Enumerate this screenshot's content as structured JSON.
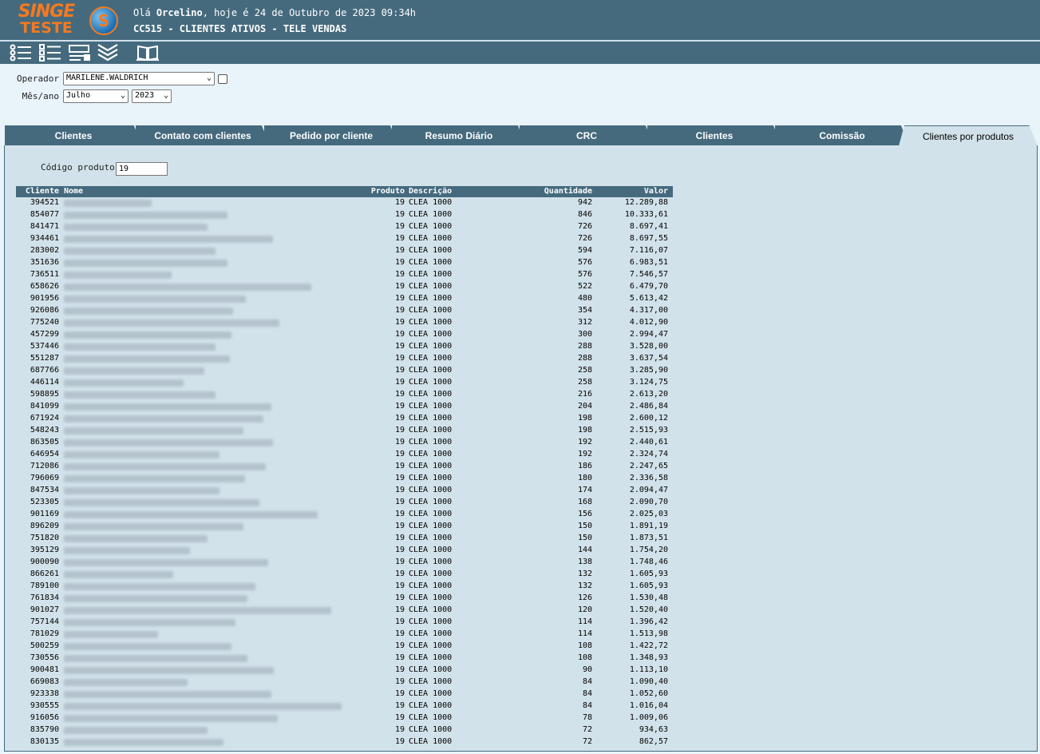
{
  "app": {
    "logo_line1": "SINGE",
    "logo_line2": "TESTE",
    "greeting_prefix": "Olá ",
    "user": "Orcelino",
    "greeting_suffix": ", hoje é 24 de Outubro de 2023 09:34h",
    "screen_title": "CC515 - CLIENTES ATIVOS - TELE VENDAS"
  },
  "toolbar": {
    "icons": [
      "list-icon",
      "checklist-icon",
      "form-icon",
      "chevrons-down-icon",
      "book-icon"
    ]
  },
  "filters": {
    "operador_label": "Operador",
    "operador_value": "MARILENE.WALDRICH",
    "mes_ano_label": "Mês/ano",
    "mes_value": "Julho",
    "ano_value": "2023"
  },
  "tabs": [
    {
      "label": "Clientes"
    },
    {
      "label": "Contato com clientes"
    },
    {
      "label": "Pedido por cliente"
    },
    {
      "label": "Resumo Diário"
    },
    {
      "label": "CRC"
    },
    {
      "label": "Clientes"
    },
    {
      "label": "Comissão"
    },
    {
      "label": "Clientes por produtos",
      "active": true
    }
  ],
  "produto_filter": {
    "label": "Código produto",
    "value": "19"
  },
  "table": {
    "columns": [
      "Cliente",
      "Nome",
      "Produto",
      "Descrição",
      "Quantidade",
      "Valor"
    ],
    "rows": [
      {
        "cliente": "394521",
        "produto": "19",
        "descricao": "CLEA 1000",
        "quantidade": "942",
        "valor": "12.289,88"
      },
      {
        "cliente": "854077",
        "produto": "19",
        "descricao": "CLEA 1000",
        "quantidade": "846",
        "valor": "10.333,61"
      },
      {
        "cliente": "841471",
        "produto": "19",
        "descricao": "CLEA 1000",
        "quantidade": "726",
        "valor": "8.697,41"
      },
      {
        "cliente": "934461",
        "produto": "19",
        "descricao": "CLEA 1000",
        "quantidade": "726",
        "valor": "8.697,55"
      },
      {
        "cliente": "283002",
        "produto": "19",
        "descricao": "CLEA 1000",
        "quantidade": "594",
        "valor": "7.116,07"
      },
      {
        "cliente": "351636",
        "produto": "19",
        "descricao": "CLEA 1000",
        "quantidade": "576",
        "valor": "6.983,51"
      },
      {
        "cliente": "736511",
        "produto": "19",
        "descricao": "CLEA 1000",
        "quantidade": "576",
        "valor": "7.546,57"
      },
      {
        "cliente": "658626",
        "produto": "19",
        "descricao": "CLEA 1000",
        "quantidade": "522",
        "valor": "6.479,70"
      },
      {
        "cliente": "901956",
        "produto": "19",
        "descricao": "CLEA 1000",
        "quantidade": "480",
        "valor": "5.613,42"
      },
      {
        "cliente": "926086",
        "produto": "19",
        "descricao": "CLEA 1000",
        "quantidade": "354",
        "valor": "4.317,00"
      },
      {
        "cliente": "775240",
        "produto": "19",
        "descricao": "CLEA 1000",
        "quantidade": "312",
        "valor": "4.012,90"
      },
      {
        "cliente": "457299",
        "produto": "19",
        "descricao": "CLEA 1000",
        "quantidade": "300",
        "valor": "2.994,47"
      },
      {
        "cliente": "537446",
        "produto": "19",
        "descricao": "CLEA 1000",
        "quantidade": "288",
        "valor": "3.528,00"
      },
      {
        "cliente": "551287",
        "produto": "19",
        "descricao": "CLEA 1000",
        "quantidade": "288",
        "valor": "3.637,54"
      },
      {
        "cliente": "687766",
        "produto": "19",
        "descricao": "CLEA 1000",
        "quantidade": "258",
        "valor": "3.285,90"
      },
      {
        "cliente": "446114",
        "produto": "19",
        "descricao": "CLEA 1000",
        "quantidade": "258",
        "valor": "3.124,75"
      },
      {
        "cliente": "598895",
        "produto": "19",
        "descricao": "CLEA 1000",
        "quantidade": "216",
        "valor": "2.613,20"
      },
      {
        "cliente": "841099",
        "produto": "19",
        "descricao": "CLEA 1000",
        "quantidade": "204",
        "valor": "2.486,84"
      },
      {
        "cliente": "671924",
        "produto": "19",
        "descricao": "CLEA 1000",
        "quantidade": "198",
        "valor": "2.600,12"
      },
      {
        "cliente": "548243",
        "produto": "19",
        "descricao": "CLEA 1000",
        "quantidade": "198",
        "valor": "2.515,93"
      },
      {
        "cliente": "863505",
        "produto": "19",
        "descricao": "CLEA 1000",
        "quantidade": "192",
        "valor": "2.440,61"
      },
      {
        "cliente": "646954",
        "produto": "19",
        "descricao": "CLEA 1000",
        "quantidade": "192",
        "valor": "2.324,74"
      },
      {
        "cliente": "712086",
        "produto": "19",
        "descricao": "CLEA 1000",
        "quantidade": "186",
        "valor": "2.247,65"
      },
      {
        "cliente": "796069",
        "produto": "19",
        "descricao": "CLEA 1000",
        "quantidade": "180",
        "valor": "2.336,58"
      },
      {
        "cliente": "847534",
        "produto": "19",
        "descricao": "CLEA 1000",
        "quantidade": "174",
        "valor": "2.094,47"
      },
      {
        "cliente": "523305",
        "produto": "19",
        "descricao": "CLEA 1000",
        "quantidade": "168",
        "valor": "2.090,70"
      },
      {
        "cliente": "901169",
        "produto": "19",
        "descricao": "CLEA 1000",
        "quantidade": "156",
        "valor": "2.025,03"
      },
      {
        "cliente": "896209",
        "produto": "19",
        "descricao": "CLEA 1000",
        "quantidade": "150",
        "valor": "1.891,19"
      },
      {
        "cliente": "751820",
        "produto": "19",
        "descricao": "CLEA 1000",
        "quantidade": "150",
        "valor": "1.873,51"
      },
      {
        "cliente": "395129",
        "produto": "19",
        "descricao": "CLEA 1000",
        "quantidade": "144",
        "valor": "1.754,20"
      },
      {
        "cliente": "900090",
        "produto": "19",
        "descricao": "CLEA 1000",
        "quantidade": "138",
        "valor": "1.748,46"
      },
      {
        "cliente": "866261",
        "produto": "19",
        "descricao": "CLEA 1000",
        "quantidade": "132",
        "valor": "1.605,93"
      },
      {
        "cliente": "789100",
        "produto": "19",
        "descricao": "CLEA 1000",
        "quantidade": "132",
        "valor": "1.605,93"
      },
      {
        "cliente": "761834",
        "produto": "19",
        "descricao": "CLEA 1000",
        "quantidade": "126",
        "valor": "1.530,48"
      },
      {
        "cliente": "901027",
        "produto": "19",
        "descricao": "CLEA 1000",
        "quantidade": "120",
        "valor": "1.520,40"
      },
      {
        "cliente": "757144",
        "produto": "19",
        "descricao": "CLEA 1000",
        "quantidade": "114",
        "valor": "1.396,42"
      },
      {
        "cliente": "781029",
        "produto": "19",
        "descricao": "CLEA 1000",
        "quantidade": "114",
        "valor": "1.513,98"
      },
      {
        "cliente": "500259",
        "produto": "19",
        "descricao": "CLEA 1000",
        "quantidade": "108",
        "valor": "1.422,72"
      },
      {
        "cliente": "730556",
        "produto": "19",
        "descricao": "CLEA 1000",
        "quantidade": "108",
        "valor": "1.348,93"
      },
      {
        "cliente": "900481",
        "produto": "19",
        "descricao": "CLEA 1000",
        "quantidade": "90",
        "valor": "1.113,10"
      },
      {
        "cliente": "669083",
        "produto": "19",
        "descricao": "CLEA 1000",
        "quantidade": "84",
        "valor": "1.090,40"
      },
      {
        "cliente": "923338",
        "produto": "19",
        "descricao": "CLEA 1000",
        "quantidade": "84",
        "valor": "1.052,60"
      },
      {
        "cliente": "930555",
        "produto": "19",
        "descricao": "CLEA 1000",
        "quantidade": "84",
        "valor": "1.016,04"
      },
      {
        "cliente": "916056",
        "produto": "19",
        "descricao": "CLEA 1000",
        "quantidade": "78",
        "valor": "1.009,06"
      },
      {
        "cliente": "835790",
        "produto": "19",
        "descricao": "CLEA 1000",
        "quantidade": "72",
        "valor": "934,63"
      },
      {
        "cliente": "830135",
        "produto": "19",
        "descricao": "CLEA 1000",
        "quantidade": "72",
        "valor": "862,57"
      }
    ]
  },
  "colors": {
    "header_bg": "#456a7e",
    "page_bg": "#e9f3fa",
    "panel_bg": "#d2e2ea",
    "logo_orange": "#f47a20"
  }
}
